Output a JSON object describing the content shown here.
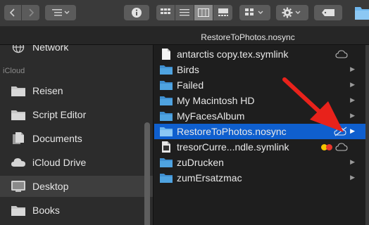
{
  "path_title": "RestoreToPhotos.nosync",
  "sidebar": {
    "partial_item": "Network",
    "heading": "iCloud",
    "items": [
      {
        "label": "Reisen",
        "icon": "folder-icon"
      },
      {
        "label": "Script Editor",
        "icon": "folder-icon"
      },
      {
        "label": "Documents",
        "icon": "document-icon"
      },
      {
        "label": "iCloud Drive",
        "icon": "cloud-icon"
      },
      {
        "label": "Desktop",
        "icon": "desktop-icon"
      },
      {
        "label": "Books",
        "icon": "folder-icon"
      }
    ],
    "selected_index": 4
  },
  "files": [
    {
      "name": "antarctis copy.tex.symlink",
      "kind": "document",
      "cloud": true
    },
    {
      "name": "Birds",
      "kind": "folder"
    },
    {
      "name": "Failed",
      "kind": "folder"
    },
    {
      "name": "My Macintosh HD",
      "kind": "folder"
    },
    {
      "name": "MyFacesAlbum",
      "kind": "folder"
    },
    {
      "name": "RestoreToPhotos.nosync",
      "kind": "folder",
      "selected": true,
      "no_cloud": true
    },
    {
      "name": "tresorCurre...ndle.symlink",
      "kind": "document-dark",
      "cloud": true,
      "tags": [
        "#f5c400",
        "#e8372c"
      ]
    },
    {
      "name": "zuDrucken",
      "kind": "folder"
    },
    {
      "name": "zumErsatzmac",
      "kind": "folder"
    }
  ],
  "colors": {
    "selection": "#0f5fce",
    "folder": "#4fa3e0",
    "arrow": "#e8221b"
  }
}
